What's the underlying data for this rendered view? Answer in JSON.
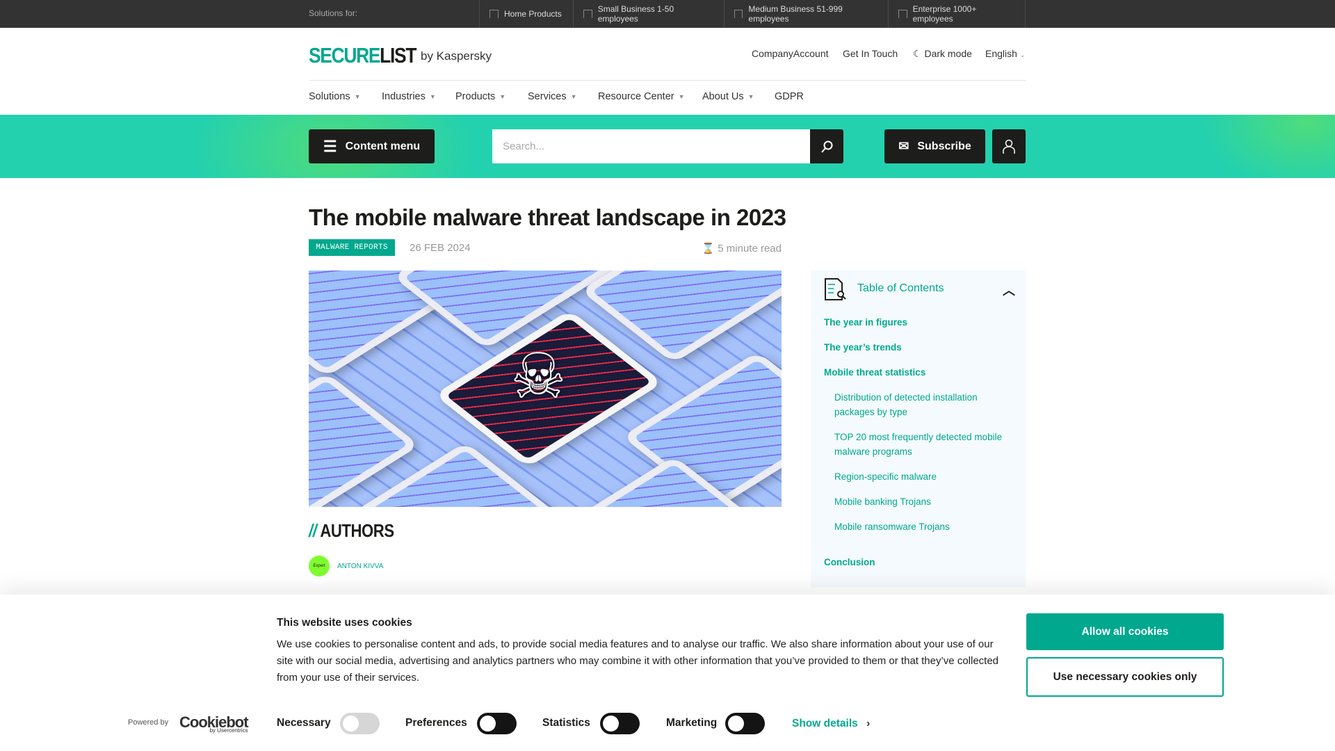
{
  "topbar": {
    "label": "Solutions for:",
    "items": [
      "Home Products",
      "Small Business 1-50 employees",
      "Medium Business 51-999 employees",
      "Enterprise 1000+ employees"
    ]
  },
  "header": {
    "logo_green": "SECURE",
    "logo_dark": "LIST",
    "by": "by Kaspersky",
    "links": {
      "account": "CompanyAccount",
      "contact": "Get In Touch",
      "dark": "Dark mode",
      "lang": "English"
    }
  },
  "nav": [
    "Solutions",
    "Industries",
    "Products",
    "Services",
    "Resource Center",
    "About Us",
    "GDPR"
  ],
  "toolbar": {
    "content_menu": "Content menu",
    "search_placeholder": "Search...",
    "subscribe": "Subscribe"
  },
  "article": {
    "title": "The mobile malware threat landscape in 2023",
    "tag": "MALWARE REPORTS",
    "date": "26 FEB 2024",
    "read_time": "5 minute read",
    "authors_heading": "AUTHORS",
    "authors_prefix": "//",
    "author": {
      "badge": "Expert",
      "name": "ANTON KIVVA"
    }
  },
  "toc": {
    "title": "Table of Contents",
    "items": [
      "The year in figures",
      "The year’s trends",
      "Mobile threat statistics",
      "Distribution of detected installation packages by type",
      "TOP 20 most frequently detected mobile malware programs",
      "Region-specific malware",
      "Mobile banking Trojans",
      "Mobile ransomware Trojans",
      "Conclusion"
    ]
  },
  "cookie": {
    "title": "This website uses cookies",
    "body": "We use cookies to personalise content and ads, to provide social media features and to analyse our traffic. We also share information about your use of our site with our social media, advertising and analytics partners who may combine it with other information that you’ve provided to them or that they’ve collected from your use of their services.",
    "powered": "Powered by",
    "brand": "Cookiebot",
    "brand_sub": "by Usercentrics",
    "toggles": [
      {
        "label": "Necessary",
        "on": true,
        "disabled": true
      },
      {
        "label": "Preferences",
        "on": false
      },
      {
        "label": "Statistics",
        "on": false
      },
      {
        "label": "Marketing",
        "on": false
      }
    ],
    "details": "Show details",
    "allow": "Allow all cookies",
    "necessary_only": "Use necessary cookies only"
  },
  "colors": {
    "accent": "#00a88e",
    "band": "#24d1ae",
    "dark": "#1d1d1b"
  }
}
